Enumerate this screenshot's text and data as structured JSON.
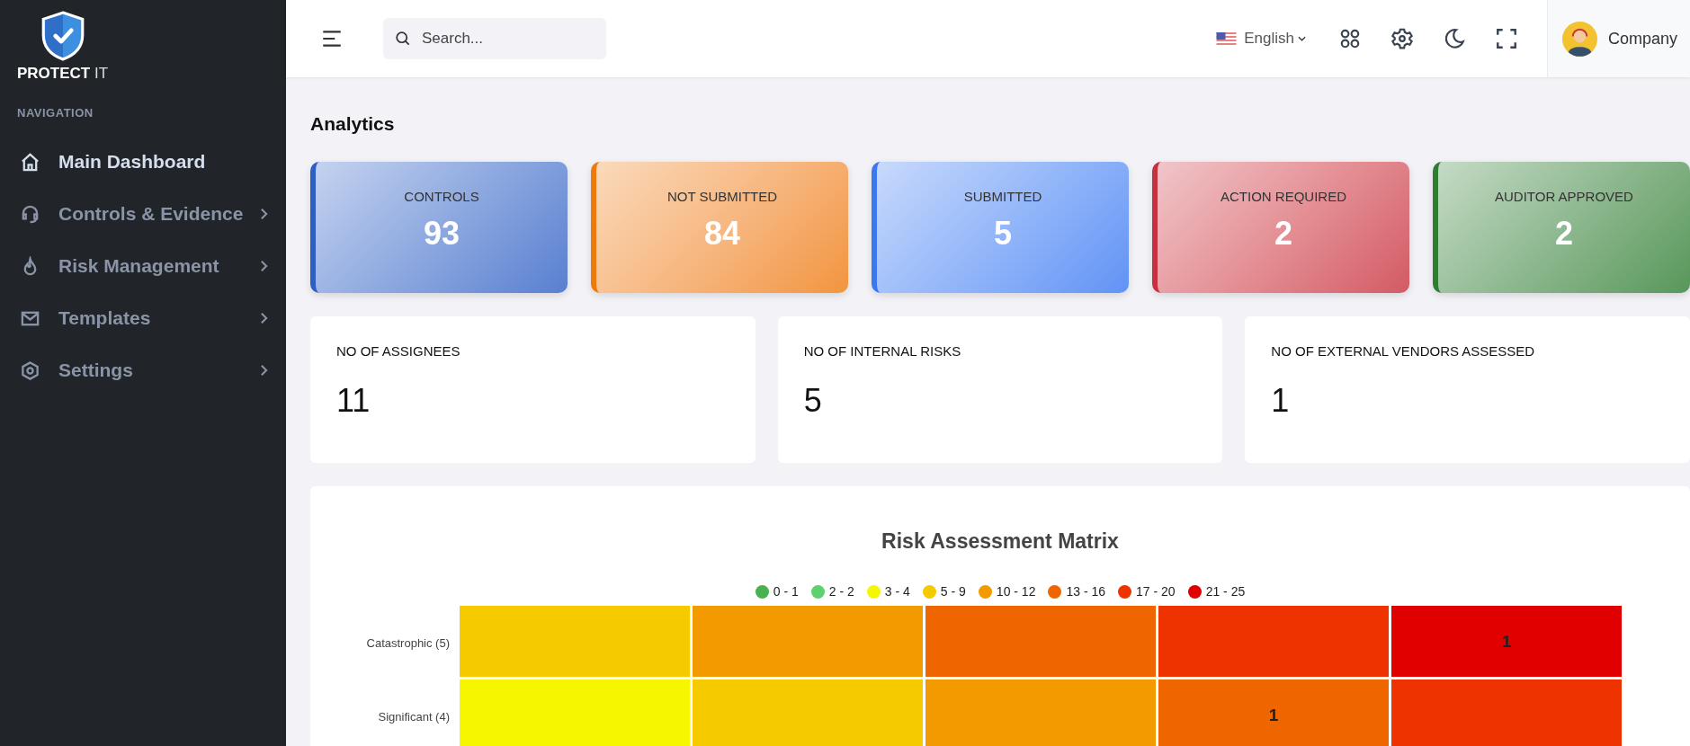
{
  "brand": {
    "name": "PROTECT",
    "suffix": "IT"
  },
  "sidebar": {
    "heading": "NAVIGATION",
    "items": [
      {
        "label": "Main Dashboard",
        "kind": "home",
        "selected": true,
        "expandable": false
      },
      {
        "label": "Controls & Evidence",
        "kind": "headset",
        "selected": false,
        "expandable": true
      },
      {
        "label": "Risk Management",
        "kind": "flame",
        "selected": false,
        "expandable": true
      },
      {
        "label": "Templates",
        "kind": "mail",
        "selected": false,
        "expandable": true
      },
      {
        "label": "Settings",
        "kind": "settings",
        "selected": false,
        "expandable": true
      }
    ]
  },
  "header": {
    "search": {
      "placeholder": "Search..."
    },
    "language": "English",
    "user": "Company"
  },
  "page_title": "Analytics",
  "status_cards": [
    {
      "label": "CONTROLS",
      "value": "93",
      "color": "#2f5fc4"
    },
    {
      "label": "NOT SUBMITTED",
      "value": "84",
      "color": "#ee7a0c"
    },
    {
      "label": "SUBMITTED",
      "value": "5",
      "color": "#3a78f2"
    },
    {
      "label": "ACTION REQUIRED",
      "value": "2",
      "color": "#c8303f"
    },
    {
      "label": "AUDITOR APPROVED",
      "value": "2",
      "color": "#2e7d32"
    }
  ],
  "stat_cards": [
    {
      "label": "NO OF ASSIGNEES",
      "value": "11"
    },
    {
      "label": "NO OF INTERNAL RISKS",
      "value": "5"
    },
    {
      "label": "NO OF EXTERNAL VENDORS ASSESSED",
      "value": "1"
    }
  ],
  "matrix": {
    "title": "Risk Assessment Matrix",
    "legend": [
      {
        "label": "0 - 1",
        "color": "#4caf50"
      },
      {
        "label": "2 - 2",
        "color": "#5fd06f"
      },
      {
        "label": "3 - 4",
        "color": "#f6f600"
      },
      {
        "label": "5 - 9",
        "color": "#f5cb00"
      },
      {
        "label": "10 - 12",
        "color": "#f29a00"
      },
      {
        "label": "13 - 16",
        "color": "#ef6500"
      },
      {
        "label": "17 - 20",
        "color": "#ef3300"
      },
      {
        "label": "21 - 25",
        "color": "#e00000"
      }
    ],
    "rows": [
      {
        "label": "Catastrophic (5)",
        "cells": [
          {
            "color": "#f5cb00"
          },
          {
            "color": "#f29a00"
          },
          {
            "color": "#ef6500"
          },
          {
            "color": "#ef3300"
          },
          {
            "color": "#e00000",
            "value": "1"
          }
        ]
      },
      {
        "label": "Significant (4)",
        "cells": [
          {
            "color": "#f6f600"
          },
          {
            "color": "#f5cb00"
          },
          {
            "color": "#f29a00"
          },
          {
            "color": "#ef6500",
            "value": "1"
          },
          {
            "color": "#ef3300"
          }
        ]
      }
    ]
  }
}
